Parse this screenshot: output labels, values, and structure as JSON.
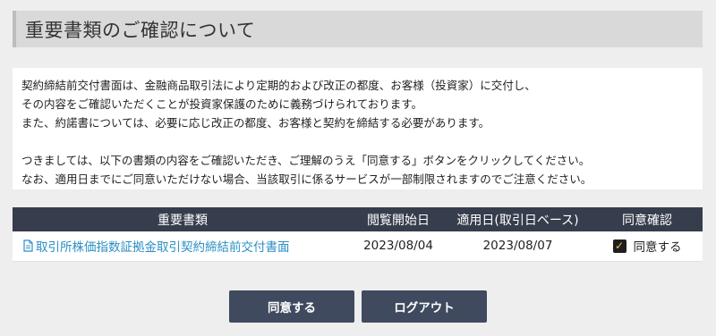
{
  "header": {
    "title": "重要書類のご確認について"
  },
  "notice": {
    "lines_1": [
      "契約締結前交付書面は、金融商品取引法により定期的および改正の都度、お客様（投資家）に交付し、",
      "その内容をご確認いただくことが投資家保護のために義務づけられております。",
      "また、約諾書については、必要に応じ改正の都度、お客様と契約を締結する必要があります。"
    ],
    "lines_2": [
      "つきましては、以下の書類の内容をご確認いただき、ご理解のうえ「同意する」ボタンをクリックしてください。",
      "なお、適用日までにご同意いただけない場合、当該取引に係るサービスが一部制限されますのでご注意ください。"
    ]
  },
  "table": {
    "headers": [
      "重要書類",
      "閲覧開始日",
      "適用日(取引日ベース)",
      "同意確認"
    ],
    "rows": [
      {
        "document": "取引所株価指数証拠金取引契約締結前交付書面",
        "view_start": "2023/08/04",
        "effective": "2023/08/07",
        "agree_label": "同意する",
        "agreed": true
      }
    ]
  },
  "buttons": {
    "agree": "同意する",
    "logout": "ログアウト"
  },
  "colors": {
    "table_header": "#363d4c",
    "button": "#3f4a5e",
    "link": "#2a8fc5"
  }
}
